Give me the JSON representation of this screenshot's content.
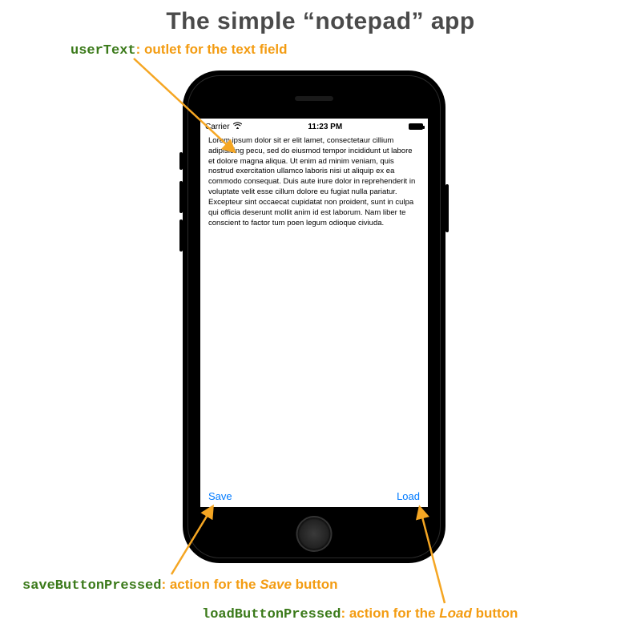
{
  "title": "The simple “notepad” app",
  "colors": {
    "callout_name": "#3b7a1a",
    "callout_desc": "#f39c12",
    "ios_tint": "#007aff"
  },
  "status_bar": {
    "carrier": "Carrier",
    "time": "11:23 PM"
  },
  "text_field": {
    "content": "Lorem ipsum dolor sit er elit lamet, consectetaur cillium adipisicing pecu, sed do eiusmod tempor incididunt ut labore et dolore magna aliqua. Ut enim ad minim veniam, quis nostrud exercitation ullamco laboris nisi ut aliquip ex ea commodo consequat. Duis aute irure dolor in reprehenderit in voluptate velit esse cillum dolore eu fugiat nulla pariatur. Excepteur sint occaecat cupidatat non proident, sunt in culpa qui officia deserunt mollit anim id est laborum. Nam liber te conscient to factor tum poen legum odioque civiuda."
  },
  "buttons": {
    "save": "Save",
    "load": "Load"
  },
  "callouts": {
    "userText": {
      "name": "userText",
      "desc": "outlet for the text field"
    },
    "save": {
      "name": "saveButtonPressed",
      "desc_pre": "action for the ",
      "desc_em": "Save",
      "desc_post": " button"
    },
    "load": {
      "name": "loadButtonPressed",
      "desc_pre": "action for the ",
      "desc_em": "Load",
      "desc_post": " button"
    }
  }
}
